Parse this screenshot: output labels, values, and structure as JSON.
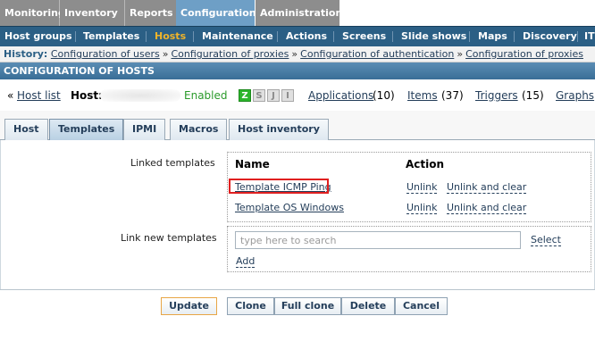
{
  "main_menu": [
    "Monitoring",
    "Inventory",
    "Reports",
    "Configuration",
    "Administration"
  ],
  "sub_menu": [
    "Host groups",
    "Templates",
    "Hosts",
    "Maintenance",
    "Actions",
    "Screens",
    "Slide shows",
    "Maps",
    "Discovery",
    "IT"
  ],
  "history": {
    "label": "History:",
    "items": [
      "Configuration of users",
      "Configuration of proxies",
      "Configuration of authentication",
      "Configuration of proxies"
    ],
    "separator": "»"
  },
  "page_title": "CONFIGURATION OF HOSTS",
  "host_row": {
    "back_arrow": "«",
    "host_list": "Host list",
    "host_label": "Host:",
    "status": "Enabled",
    "availability": [
      "Z",
      "S",
      "J",
      "I"
    ],
    "applications": "Applications",
    "applications_count": "(10)",
    "items": "Items",
    "items_count": "(37)",
    "triggers": "Triggers",
    "triggers_count": "(15)",
    "graphs": "Graphs"
  },
  "tabs": [
    "Host",
    "Templates",
    "IPMI",
    "Macros",
    "Host inventory"
  ],
  "linked": {
    "label": "Linked templates",
    "col_name": "Name",
    "col_action": "Action",
    "rows": [
      {
        "name": "Template ICMP Ping",
        "unlink": "Unlink",
        "unlink_clear": "Unlink and clear"
      },
      {
        "name": "Template OS Windows",
        "unlink": "Unlink",
        "unlink_clear": "Unlink and clear"
      }
    ]
  },
  "new_templates": {
    "label": "Link new templates",
    "placeholder": "type here to search",
    "select": "Select",
    "add": "Add"
  },
  "buttons": {
    "update": "Update",
    "clone": "Clone",
    "full_clone": "Full clone",
    "delete": "Delete",
    "cancel": "Cancel"
  },
  "colors": {
    "menu_active": "#6e9fc6",
    "submenu_bg": "#2b5f85",
    "submenu_active": "#f0b429",
    "enabled": "#2a9a2a",
    "highlight": "#e02020"
  }
}
